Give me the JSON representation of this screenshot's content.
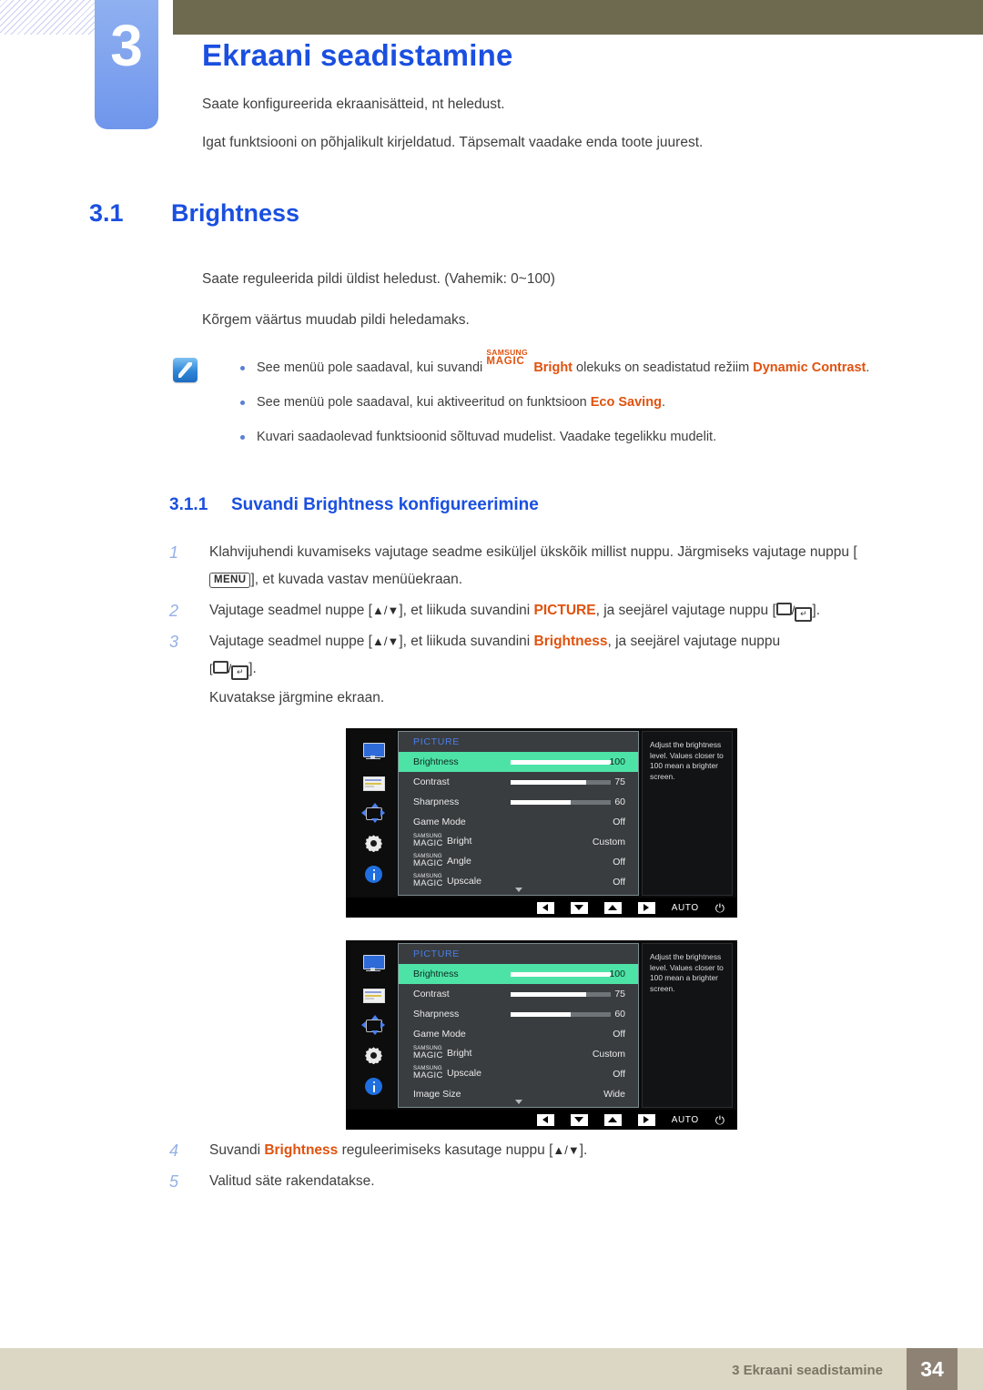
{
  "header": {
    "chapter_number": "3",
    "chapter_title": "Ekraani seadistamine",
    "intro_line_1": "Saate konfigureerida ekraanisätteid, nt heledust.",
    "intro_line_2": "Igat funktsiooni on põhjalikult kirjeldatud. Täpsemalt vaadake enda toote juurest."
  },
  "section": {
    "number": "3.1",
    "title": "Brightness",
    "para_range": "Saate reguleerida pildi üldist heledust. (Vahemik: 0~100)",
    "para_higher": "Kõrgem väärtus muudab pildi heledamaks."
  },
  "note": {
    "bullet1_a": "See menüü pole saadaval, kui suvandi ",
    "bullet1_magic_top": "SAMSUNG",
    "bullet1_magic_bottom": "MAGIC",
    "bullet1_bright": "Bright",
    "bullet1_b": " olekuks on seadistatud režiim ",
    "bullet1_hl": "Dynamic Contrast",
    "bullet1_c": ".",
    "bullet2_a": "See menüü pole saadaval, kui aktiveeritud on funktsioon ",
    "bullet2_hl": "Eco Saving",
    "bullet2_b": ".",
    "bullet3": "Kuvari saadaolevad funktsioonid sõltuvad mudelist. Vaadake tegelikku mudelit."
  },
  "subsection": {
    "number": "3.1.1",
    "title": "Suvandi Brightness konfigureerimine"
  },
  "steps": {
    "s1_num": "1",
    "s1_a": "Klahvijuhendi kuvamiseks vajutage seadme esiküljel ükskõik millist nuppu. Järgmiseks vajutage nuppu [",
    "s1_key": "MENU",
    "s1_b": "], et kuvada vastav menüüekraan.",
    "s2_num": "2",
    "s2_a": "Vajutage seadmel nuppe [",
    "s2_arrows": "▲/▼",
    "s2_b": "], et liikuda suvandini ",
    "s2_hl": "PICTURE",
    "s2_c": ", ja seejärel vajutage nuppu [",
    "s2_d": "].",
    "s3_num": "3",
    "s3_a": "Vajutage seadmel nuppe [",
    "s3_arrows": "▲/▼",
    "s3_b": "], et liikuda suvandini ",
    "s3_hl": "Brightness",
    "s3_c": ", ja seejärel vajutage nuppu",
    "s3_d": "].",
    "s3_note": "Kuvatakse järgmine ekraan.",
    "s4_num": "4",
    "s4_a": "Suvandi ",
    "s4_hl": "Brightness",
    "s4_b": " reguleerimiseks kasutage nuppu [",
    "s4_arrows": "▲/▼",
    "s4_c": "].",
    "s5_num": "5",
    "s5_text": "Valitud säte rakendatakse."
  },
  "osd": {
    "category": "PICTURE",
    "help_text": "Adjust the brightness level. Values closer to 100 mean a brighter screen.",
    "bottom_bar": {
      "auto_label": "AUTO",
      "power_glyph": "⏻"
    },
    "menu1": {
      "rows": [
        {
          "label": "Brightness",
          "value": "100",
          "bar": 100,
          "selected": true,
          "magic": false
        },
        {
          "label": "Contrast",
          "value": "75",
          "bar": 75,
          "selected": false,
          "magic": false
        },
        {
          "label": "Sharpness",
          "value": "60",
          "bar": 60,
          "selected": false,
          "magic": false
        },
        {
          "label": "Game Mode",
          "value": "Off",
          "bar": null,
          "selected": false,
          "magic": false
        },
        {
          "label": "Bright",
          "value": "Custom",
          "bar": null,
          "selected": false,
          "magic": true
        },
        {
          "label": "Angle",
          "value": "Off",
          "bar": null,
          "selected": false,
          "magic": true
        },
        {
          "label": "Upscale",
          "value": "Off",
          "bar": null,
          "selected": false,
          "magic": true
        }
      ]
    },
    "menu2": {
      "rows": [
        {
          "label": "Brightness",
          "value": "100",
          "bar": 100,
          "selected": true,
          "magic": false
        },
        {
          "label": "Contrast",
          "value": "75",
          "bar": 75,
          "selected": false,
          "magic": false
        },
        {
          "label": "Sharpness",
          "value": "60",
          "bar": 60,
          "selected": false,
          "magic": false
        },
        {
          "label": "Game Mode",
          "value": "Off",
          "bar": null,
          "selected": false,
          "magic": false
        },
        {
          "label": "Bright",
          "value": "Custom",
          "bar": null,
          "selected": false,
          "magic": true
        },
        {
          "label": "Upscale",
          "value": "Off",
          "bar": null,
          "selected": false,
          "magic": true
        },
        {
          "label": "Image Size",
          "value": "Wide",
          "bar": null,
          "selected": false,
          "magic": false
        }
      ]
    },
    "magic_top": "SAMSUNG",
    "magic_bottom": "MAGIC"
  },
  "footer": {
    "text": "3 Ekraani seadistamine",
    "page": "34"
  },
  "colors": {
    "heading_blue": "#1a4fe0",
    "highlight_orange": "#e0520e",
    "olive": "#6e6a4f",
    "chapter_blue": "#7ea2ee",
    "footer_bg": "#dcd6c4",
    "footer_page_bg": "#8d8274",
    "osd_selected": "#4de3a7"
  }
}
